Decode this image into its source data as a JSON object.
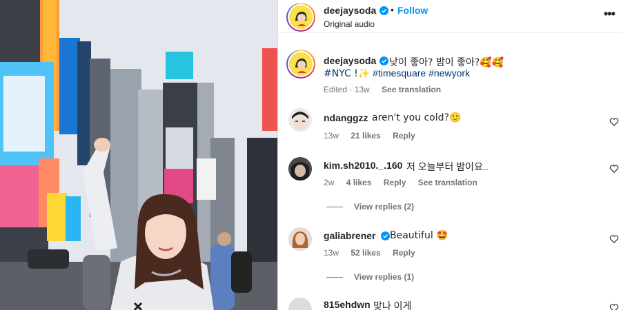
{
  "post": {
    "author": "deejaysoda",
    "follow_label": "Follow",
    "dot": "•",
    "audio_label": "Original audio",
    "more_label": "•••"
  },
  "caption": {
    "author": "deejaysoda",
    "text": "낮이 좋아? 밤이 좋아?🥰🥰",
    "tags_prefix": "#NYC !✨",
    "tag_2": "#timesquare",
    "tag_3": "#newyork",
    "edited": "Edited · 13w",
    "see_translation": "See translation"
  },
  "comments": [
    {
      "user": "ndanggzz",
      "text": "aren't you cold?🙂",
      "age": "13w",
      "likes": "21 likes",
      "reply": "Reply"
    },
    {
      "user": "kim.sh2010._.160",
      "text": "저 오늘부터 밤이요..",
      "age": "2w",
      "likes": "4 likes",
      "reply": "Reply",
      "see_translation": "See translation",
      "view_replies": "View replies (2)"
    },
    {
      "user": "galiabrener",
      "text": "Beautiful 🤩",
      "age": "13w",
      "likes": "52 likes",
      "reply": "Reply",
      "view_replies": "View replies (1)"
    },
    {
      "user": "815ehdwn",
      "text": "맞나 이게"
    }
  ],
  "colors": {
    "accent": "#0095f6",
    "hashtag": "#00376b",
    "verified": "#0095f6",
    "muted": "#737373"
  },
  "icons": {
    "verified": "verified-badge-icon",
    "more": "more-options-icon",
    "heart": "heart-outline-icon"
  }
}
